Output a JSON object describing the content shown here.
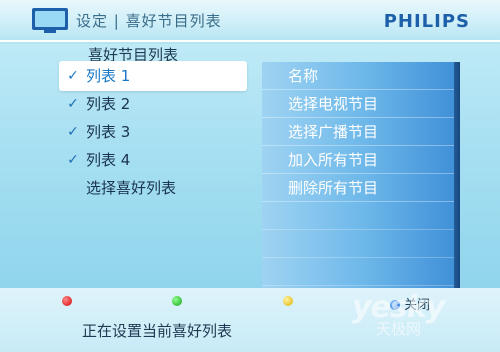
{
  "header": {
    "title": "设定 | 喜好节目列表",
    "brand": "PHILIPS"
  },
  "subtitle": "喜好节目列表",
  "left_menu": {
    "items": [
      {
        "label": "列表 1",
        "checked": true,
        "selected": true
      },
      {
        "label": "列表 2",
        "checked": true,
        "selected": false
      },
      {
        "label": "列表 3",
        "checked": true,
        "selected": false
      },
      {
        "label": "列表 4",
        "checked": true,
        "selected": false
      },
      {
        "label": "选择喜好列表",
        "checked": false,
        "selected": false
      }
    ],
    "check_glyph": "✓"
  },
  "right_menu": {
    "items": [
      {
        "label": "名称"
      },
      {
        "label": "选择电视节目"
      },
      {
        "label": "选择广播节目"
      },
      {
        "label": "加入所有节目"
      },
      {
        "label": "删除所有节目"
      }
    ]
  },
  "footer": {
    "buttons": [
      {
        "color": "red",
        "hex": "#d40000",
        "label": ""
      },
      {
        "color": "green",
        "hex": "#16a316",
        "label": ""
      },
      {
        "color": "yellow",
        "hex": "#e0b000",
        "label": ""
      },
      {
        "color": "blue",
        "hex": "#1d5fd0",
        "label": "关闭"
      }
    ],
    "status": "正在设置当前喜好列表"
  },
  "watermark": {
    "text": "yesky",
    "subtext": "天极网"
  },
  "colors": {
    "accent": "#1a78c8",
    "brand": "#1d5fa8",
    "panel": "#6fb9ea"
  }
}
